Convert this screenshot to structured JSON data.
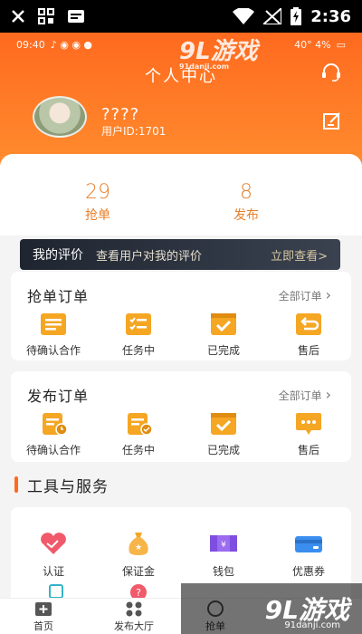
{
  "system_status": {
    "time": "2:36",
    "icons": [
      "close-icon",
      "grid-icon",
      "news-icon",
      "wifi-icon",
      "no-signal-icon",
      "battery-charging-icon"
    ]
  },
  "inner_status": {
    "time": "09:40",
    "right": "40° 4%"
  },
  "watermark_top": {
    "text": "9L游戏",
    "site": "91danji.com"
  },
  "header": {
    "title": "个人中心",
    "username": "????",
    "user_id": "用户ID:1701"
  },
  "stats": [
    {
      "value": "29",
      "label": "抢单"
    },
    {
      "value": "8",
      "label": "发布"
    }
  ],
  "review": {
    "label": "我的评价",
    "desc": "查看用户对我的评价",
    "action": "立即查看>"
  },
  "grab_orders": {
    "title": "抢单订单",
    "all": "全部订单",
    "items": [
      {
        "label": "待确认合作",
        "icon": "clipboard-icon"
      },
      {
        "label": "任务中",
        "icon": "checklist-icon"
      },
      {
        "label": "已完成",
        "icon": "check-box-icon"
      },
      {
        "label": "售后",
        "icon": "return-icon"
      }
    ]
  },
  "publish_orders": {
    "title": "发布订单",
    "all": "全部订单",
    "items": [
      {
        "label": "待确认合作",
        "icon": "doc-clock-icon"
      },
      {
        "label": "任务中",
        "icon": "doc-check-icon"
      },
      {
        "label": "已完成",
        "icon": "check-box-icon"
      },
      {
        "label": "售后",
        "icon": "chat-bubble-icon"
      }
    ]
  },
  "tools": {
    "title": "工具与服务",
    "items": [
      {
        "label": "认证",
        "icon": "heart-handshake-icon"
      },
      {
        "label": "保证金",
        "icon": "money-bag-icon"
      },
      {
        "label": "钱包",
        "icon": "wallet-icon"
      },
      {
        "label": "优惠券",
        "icon": "coupon-icon"
      }
    ]
  },
  "tabbar": [
    {
      "label": "首页",
      "icon": "home-icon"
    },
    {
      "label": "发布大厅",
      "icon": "apps-icon"
    },
    {
      "label": "抢单",
      "icon": "grab-icon"
    }
  ],
  "watermark_bottom": {
    "text": "9L游戏",
    "site": "91danji.com"
  },
  "colors": {
    "accent": "#ff6a1f",
    "stat": "#e87f2b",
    "icon_orange": "#f5a623"
  }
}
